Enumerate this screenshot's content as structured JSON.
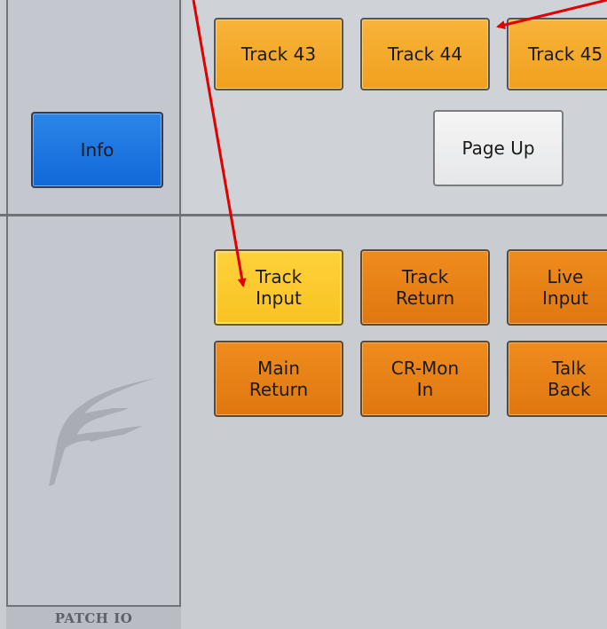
{
  "left_panel": {
    "info_label": "Info",
    "patch_label": "PATCH IO",
    "logo_icon": "f-logo-icon"
  },
  "track_row": {
    "track43": "Track 43",
    "track44": "Track 44",
    "track45": "Track 45"
  },
  "page_up_label": "Page Up",
  "io_grid": {
    "track_input": "Track\nInput",
    "track_return": "Track\nReturn",
    "live_input": "Live\nInput",
    "main_return": "Main\nReturn",
    "cr_mon_in": "CR-Mon\nIn",
    "talk_back": "Talk\nBack"
  },
  "colors": {
    "amber": "#f0a01e",
    "orange": "#e07710",
    "yellow": "#f8c223",
    "blue": "#1168d8",
    "arrow": "#e00000"
  }
}
